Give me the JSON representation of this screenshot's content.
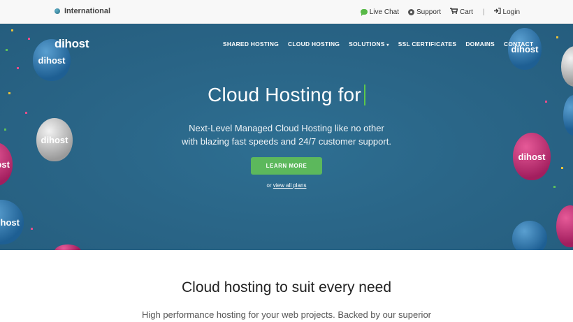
{
  "topbar": {
    "region": "International",
    "links": [
      {
        "label": "Live Chat",
        "icon": "chat-icon"
      },
      {
        "label": "Support",
        "icon": "support-icon"
      },
      {
        "label": "Cart",
        "icon": "cart-icon"
      },
      {
        "label": "Login",
        "icon": "login-icon"
      }
    ],
    "separator": "|"
  },
  "header": {
    "logo": "dihost",
    "nav": [
      {
        "label": "SHARED HOSTING"
      },
      {
        "label": "CLOUD HOSTING"
      },
      {
        "label": "SOLUTIONS",
        "caret": "▾"
      },
      {
        "label": "SSL CERTIFICATES"
      },
      {
        "label": "DOMAINS"
      },
      {
        "label": "CONTACT"
      }
    ]
  },
  "hero": {
    "title": "Cloud Hosting for",
    "subtitle_line1": "Next-Level Managed Cloud Hosting like no other",
    "subtitle_line2": "with blazing fast speeds and 24/7 customer support.",
    "cta_label": "LEARN MORE",
    "or_text": "or",
    "plans_link": "view all plans",
    "balloon_text": "dihost"
  },
  "section": {
    "title": "Cloud hosting to suit every need",
    "text": "High performance hosting for your web projects. Backed by our superior"
  },
  "colors": {
    "hero_bg": "#2a6688",
    "cta": "#5cb85c",
    "cursor": "#5cc84a",
    "balloon_blue": "#2a6fa5",
    "balloon_pink": "#c42d75",
    "balloon_grey": "#c4c4c4"
  }
}
